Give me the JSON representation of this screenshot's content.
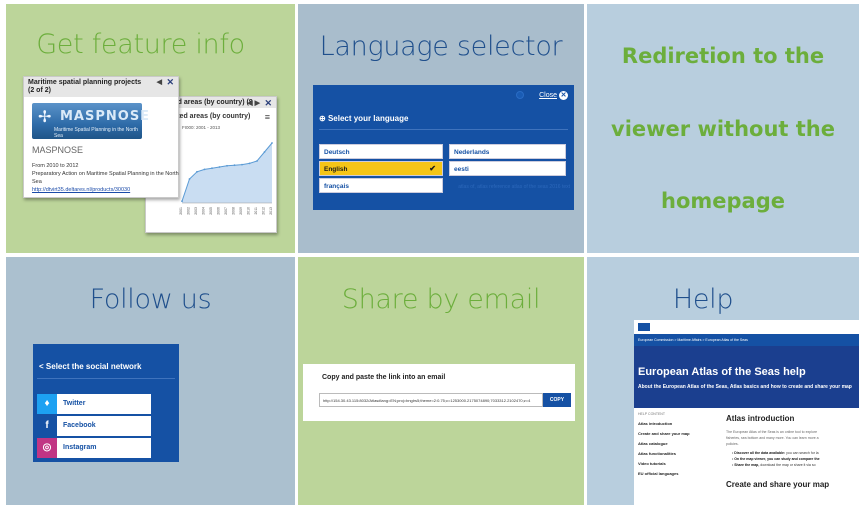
{
  "tiles": {
    "feature_info": {
      "title": "Get feature info",
      "popup_front": {
        "title": "Maritime spatial planning projects (2 of 2)",
        "nav": "◀",
        "logo_text": "MASPNOSE",
        "logo_subtitle": "Maritime Spatial Planning in the North Sea",
        "name": "MASPNOSE",
        "years": "From 2010 to 2012",
        "description": "Preparatory Action on Maritime Spatial Planning in the North Sea",
        "link": "http://dtvirt35.deltares.nl/products/30030"
      },
      "popup_back": {
        "title": "protected areas (by country) (8",
        "nav": "◀ ▶",
        "chart_title": "e protected areas (by country)",
        "chart_subtitle": "FI000: 2001 - 2013",
        "chart_data": {
          "type": "area",
          "x": [
            "2001",
            "2002",
            "2003",
            "2004",
            "2005",
            "2006",
            "2007",
            "2008",
            "2009",
            "2010",
            "2011",
            "2012",
            "2013"
          ],
          "values": [
            3,
            40,
            52,
            56,
            58,
            60,
            62,
            63,
            64,
            66,
            70,
            85,
            100
          ],
          "ylim": [
            0,
            110
          ],
          "title": "",
          "xlabel": "",
          "ylabel": ""
        }
      }
    },
    "language": {
      "title": "Language selector",
      "close_label": "Close",
      "heading": "Select your language",
      "options": [
        "Deutsch",
        "Nederlands",
        "English",
        "eesti",
        "français"
      ],
      "selected": "English",
      "faded_text": "atlas of, atlas reference atlas of the seas 2016 text"
    },
    "redirection": {
      "lines": [
        "Rediretion to the",
        "viewer without the",
        "homepage"
      ]
    },
    "follow": {
      "title": "Follow us",
      "heading": "Select the social network",
      "networks": [
        {
          "label": "Twitter",
          "icon": "twitter-icon",
          "color": "#1da1f2"
        },
        {
          "label": "Facebook",
          "icon": "facebook-icon",
          "color": "#1551a4"
        },
        {
          "label": "Instagram",
          "icon": "instagram-icon",
          "color": "#c13584"
        }
      ]
    },
    "share": {
      "title": "Share by email",
      "heading": "Copy and paste the link into an email",
      "url": "http://154.30.43.115:8032/Atlas#lang=EN;proj=bnglrs5;theme=2:0.75;c=1253000.2175074890;7033312.2102470;z=4",
      "copy_label": "COPY"
    },
    "help": {
      "title": "Help",
      "breadcrumb": "European Commission > Maritime Affairs > European Atlas of the Seas",
      "page_title": "European Atlas of the Seas help",
      "page_subtitle": "About the European Atlas of the Seas, Atlas basics and how to create and share your map",
      "side_title": "HELP CONTENT",
      "side_items": [
        "Atlas introduction",
        "Create and share your map",
        "Atlas catalogue",
        "Atlas functionalities",
        "Video tutorials",
        "EU official languages"
      ],
      "section1": "Atlas introduction",
      "intro_p1": "The European Atlas of the Seas is an online tool to explore",
      "intro_p2": "fisheries, sea bottom and many more. You can learn more a",
      "intro_p3": "policies.",
      "bullets": [
        {
          "b": "Discover all the data available:",
          "t": " you can search for la"
        },
        {
          "b": "On the map viewer, you can study and compare the",
          "t": ""
        },
        {
          "b": "Share the map,",
          "t": " download the map or share it via so"
        }
      ],
      "section2": "Create and share your map"
    }
  },
  "colors": {
    "green_tile": "#bcd59a",
    "blue_tile": "#abc0cf",
    "eu_blue": "#1551a4",
    "accent_green": "#6cae3c",
    "selected_yellow": "#f5c518"
  }
}
